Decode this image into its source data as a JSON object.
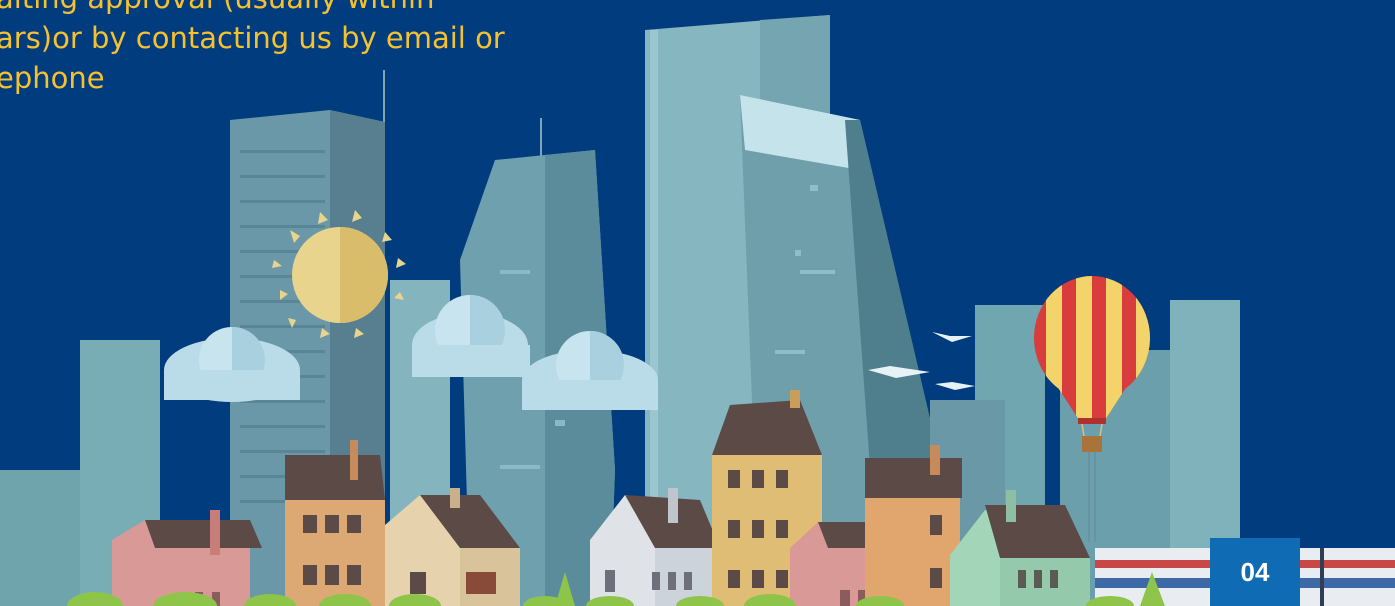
{
  "slide": {
    "body_lines": [
      "aiting approval (usually within",
      "ars)or by contacting us by email or",
      "ephone"
    ],
    "page_number": "04"
  },
  "colors": {
    "background": "#003c7e",
    "text": "#f5c12e",
    "page_badge": "#0e6bb4",
    "sun": "#e8d48c",
    "balloon_red": "#d83c3c",
    "balloon_yellow": "#f2d46a",
    "cloud": "#b9dce8"
  }
}
